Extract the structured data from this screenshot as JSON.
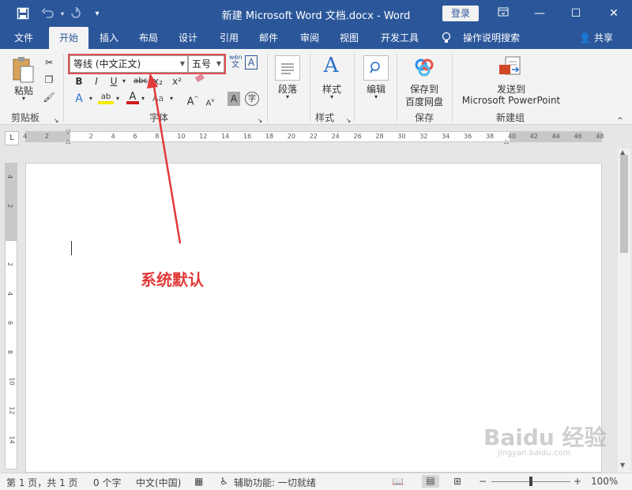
{
  "titlebar": {
    "title": "新建 Microsoft Word 文档.docx  -  Word",
    "signin": "登录",
    "save_icon": "save-icon",
    "undo_icon": "undo-icon",
    "redo_icon": "redo-icon"
  },
  "tabs": [
    "文件",
    "开始",
    "插入",
    "布局",
    "设计",
    "引用",
    "邮件",
    "审阅",
    "视图",
    "开发工具",
    "操作说明搜索"
  ],
  "share": "共享",
  "ribbon": {
    "clipboard": {
      "paste": "粘贴",
      "label": "剪贴板"
    },
    "font": {
      "font_name": "等线 (中文正文)",
      "font_size": "五号",
      "label": "字体",
      "phonetic_top": "wén",
      "phonetic_bottom": "文",
      "border_char": "A",
      "bold": "B",
      "italic": "I",
      "underline": "U",
      "strike": "abc",
      "subscript": "x₂",
      "superscript": "x²",
      "grow": "A",
      "shrink": "A",
      "clear": "Aa",
      "effect": "A",
      "highlight": "ab",
      "color": "A",
      "char_shading": "A",
      "enclose": "字"
    },
    "paragraph": {
      "label": "段落"
    },
    "styles": {
      "button": "样式",
      "label": "样式"
    },
    "editing": {
      "button": "编辑"
    },
    "save": {
      "button_line1": "保存到",
      "button_line2": "百度网盘",
      "label": "保存"
    },
    "send": {
      "button_line1": "发送到",
      "button_line2": "Microsoft PowerPoint",
      "label": "新建组"
    }
  },
  "ruler_ticks": [
    "4",
    "2",
    "",
    "2",
    "4",
    "6",
    "8",
    "10",
    "12",
    "14",
    "16",
    "18",
    "20",
    "22",
    "24",
    "26",
    "28",
    "30",
    "32",
    "34",
    "36",
    "38",
    "40",
    "42",
    "44",
    "46",
    "48"
  ],
  "vruler_ticks": [
    "4",
    "2",
    "",
    "2",
    "4",
    "6",
    "8",
    "10",
    "12",
    "14"
  ],
  "annotation": "系统默认",
  "status": {
    "page": "第 1 页，共 1 页",
    "words": "0 个字",
    "lang": "中文(中国)",
    "access": "辅助功能: 一切就绪",
    "zoom": "100%"
  },
  "watermark": "Baidu 经验",
  "watermark_sub": "jingyan.baidu.com",
  "colors": {
    "brand": "#2b579a",
    "annotation": "#e23a3a"
  }
}
